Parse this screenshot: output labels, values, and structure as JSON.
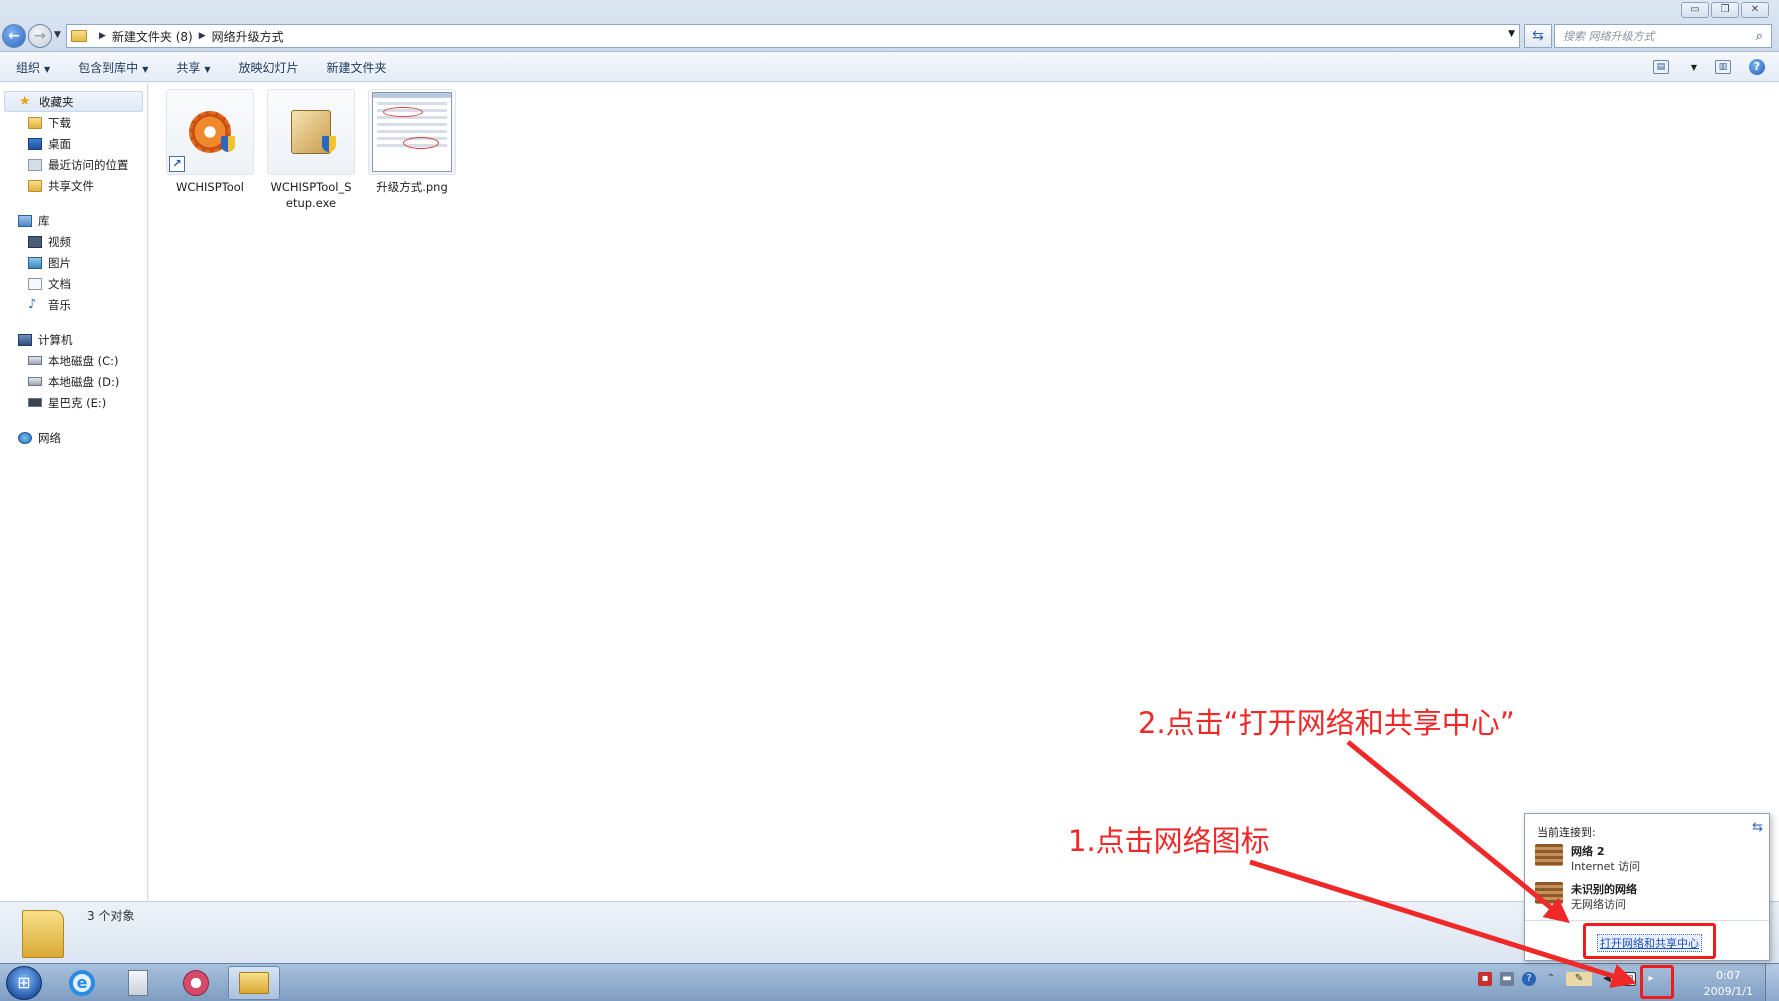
{
  "window": {
    "buttons": {
      "minimize": "▭",
      "restore": "❐",
      "close": "✕"
    },
    "address": {
      "crumbs": [
        "新建文件夹 (8)",
        "网络升级方式"
      ]
    },
    "search": {
      "placeholder": "搜索 网络升级方式"
    }
  },
  "toolbar": {
    "items": [
      {
        "label": "组织",
        "has_dropdown": true
      },
      {
        "label": "包含到库中",
        "has_dropdown": true
      },
      {
        "label": "共享",
        "has_dropdown": true
      },
      {
        "label": "放映幻灯片",
        "has_dropdown": false
      },
      {
        "label": "新建文件夹",
        "has_dropdown": false
      }
    ]
  },
  "sidebar": {
    "favorites": {
      "label": "收藏夹",
      "items": [
        "下载",
        "桌面",
        "最近访问的位置",
        "共享文件"
      ]
    },
    "libraries": {
      "label": "库",
      "items": [
        "视频",
        "图片",
        "文档",
        "音乐"
      ]
    },
    "computer": {
      "label": "计算机",
      "items": [
        "本地磁盘 (C:)",
        "本地磁盘 (D:)",
        "星巴克 (E:)"
      ]
    },
    "network": {
      "label": "网络"
    }
  },
  "files": [
    {
      "name": "WCHISPTool",
      "icon": "gear-shortcut-icon"
    },
    {
      "name": "WCHISPTool_Setup.exe",
      "icon": "installer-icon"
    },
    {
      "name": "升级方式.png",
      "icon": "image-thumbnail"
    }
  ],
  "status": {
    "count": "3 个对象"
  },
  "network_popup": {
    "title": "当前连接到:",
    "networks": [
      {
        "name": "网络  2",
        "status": "Internet 访问"
      },
      {
        "name": "未识别的网络",
        "status": "无网络访问"
      }
    ],
    "link": "打开网络和共享中心"
  },
  "clock": {
    "time": "0:07",
    "date": "2009/1/1"
  },
  "annotations": {
    "step1": "1.点击网络图标",
    "step2": "2.点击“打开网络和共享中心”",
    "color": "#f02828"
  }
}
